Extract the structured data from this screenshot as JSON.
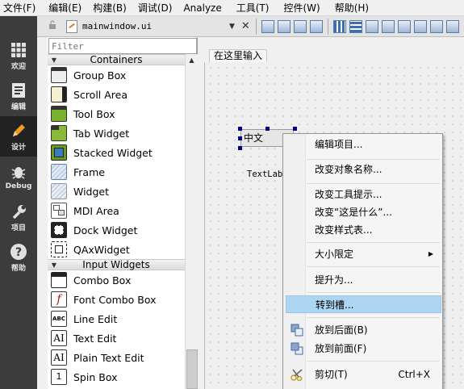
{
  "menubar": {
    "items": [
      "文件(F)",
      "编辑(E)",
      "构建(B)",
      "调试(D)",
      "Analyze",
      "工具(T)",
      "控件(W)",
      "帮助(H)"
    ]
  },
  "modes": [
    {
      "label": "欢迎",
      "icon": "grid-icon"
    },
    {
      "label": "编辑",
      "icon": "document-icon"
    },
    {
      "label": "设计",
      "icon": "pencil-icon"
    },
    {
      "label": "Debug",
      "icon": "bug-icon"
    },
    {
      "label": "项目",
      "icon": "wrench-icon"
    },
    {
      "label": "帮助",
      "icon": "question-icon"
    }
  ],
  "file_toolbar": {
    "filename": "mainwindow.ui"
  },
  "widget_box": {
    "filter_placeholder": "Filter",
    "categories": [
      {
        "title": "Containers",
        "items": [
          {
            "label": "Group Box",
            "icon": "group-box-icon"
          },
          {
            "label": "Scroll Area",
            "icon": "scroll-area-icon"
          },
          {
            "label": "Tool Box",
            "icon": "tool-box-icon"
          },
          {
            "label": "Tab Widget",
            "icon": "tab-widget-icon"
          },
          {
            "label": "Stacked Widget",
            "icon": "stacked-widget-icon"
          },
          {
            "label": "Frame",
            "icon": "frame-icon"
          },
          {
            "label": "Widget",
            "icon": "widget-icon"
          },
          {
            "label": "MDI Area",
            "icon": "mdi-area-icon"
          },
          {
            "label": "Dock Widget",
            "icon": "dock-widget-icon"
          },
          {
            "label": "QAxWidget",
            "icon": "qaxwidget-icon"
          }
        ]
      },
      {
        "title": "Input Widgets",
        "items": [
          {
            "label": "Combo Box",
            "icon": "combo-box-icon"
          },
          {
            "label": "Font Combo Box",
            "icon": "font-combo-box-icon"
          },
          {
            "label": "Line Edit",
            "icon": "line-edit-icon",
            "glyph": "ABC"
          },
          {
            "label": "Text Edit",
            "icon": "text-edit-icon",
            "glyph": "AI"
          },
          {
            "label": "Plain Text Edit",
            "icon": "plain-text-edit-icon",
            "glyph": "AI"
          },
          {
            "label": "Spin Box",
            "icon": "spin-box-icon",
            "glyph": "1"
          }
        ]
      }
    ]
  },
  "form": {
    "menu_entry": "在这里输入",
    "selected_widget_text": "中文",
    "text_label": "TextLabe"
  },
  "context_menu": {
    "items": [
      {
        "label": "编辑项目..."
      },
      {
        "label": "改变对象名称..."
      },
      {
        "label": "改变工具提示..."
      },
      {
        "label": "改变“这是什么”..."
      },
      {
        "label": "改变样式表..."
      },
      {
        "label": "大小限定",
        "submenu": true
      },
      {
        "label": "提升为..."
      },
      {
        "label": "转到槽...",
        "highlighted": true
      },
      {
        "label": "放到后面(B)",
        "icon": "send-to-back-icon"
      },
      {
        "label": "放到前面(F)",
        "icon": "bring-to-front-icon"
      },
      {
        "label": "剪切(T)",
        "shortcut": "Ctrl+X",
        "icon": "cut-icon"
      }
    ]
  }
}
